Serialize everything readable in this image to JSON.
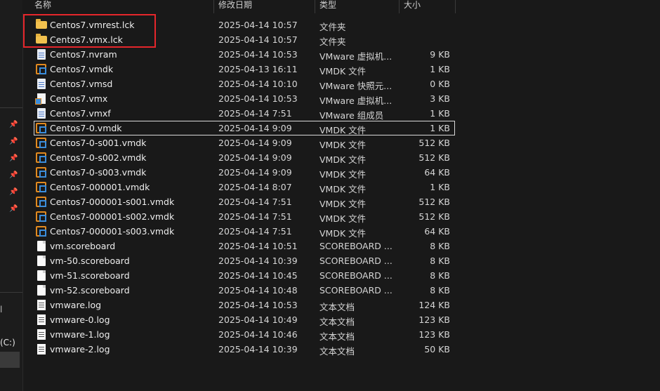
{
  "columns": {
    "name": "名称",
    "modified": "修改日期",
    "type": "类型",
    "size": "大小"
  },
  "nav": {
    "drive_label": "(C:)",
    "fragment_label": "l"
  },
  "files": [
    {
      "name": "Centos7.vmrest.lck",
      "date": "2025-04-14 10:57",
      "type": "文件夹",
      "size": "",
      "icon": "folder-icon"
    },
    {
      "name": "Centos7.vmx.lck",
      "date": "2025-04-14 10:57",
      "type": "文件夹",
      "size": "",
      "icon": "folder-icon"
    },
    {
      "name": "Centos7.nvram",
      "date": "2025-04-14 10:53",
      "type": "VMware 虚拟机...",
      "size": "9 KB",
      "icon": "nvram-file-icon"
    },
    {
      "name": "Centos7.vmdk",
      "date": "2025-04-13 16:11",
      "type": "VMDK 文件",
      "size": "1 KB",
      "icon": "vmdk-file-icon"
    },
    {
      "name": "Centos7.vmsd",
      "date": "2025-04-14 10:10",
      "type": "VMware 快照元...",
      "size": "0 KB",
      "icon": "vmsd-file-icon"
    },
    {
      "name": "Centos7.vmx",
      "date": "2025-04-14 10:53",
      "type": "VMware 虚拟机...",
      "size": "3 KB",
      "icon": "vmx-file-icon"
    },
    {
      "name": "Centos7.vmxf",
      "date": "2025-04-14 7:51",
      "type": "VMware 组成员",
      "size": "1 KB",
      "icon": "vmxf-file-icon"
    },
    {
      "name": "Centos7-0.vmdk",
      "date": "2025-04-14 9:09",
      "type": "VMDK 文件",
      "size": "1 KB",
      "icon": "vmdk-file-icon"
    },
    {
      "name": "Centos7-0-s001.vmdk",
      "date": "2025-04-14 9:09",
      "type": "VMDK 文件",
      "size": "512 KB",
      "icon": "vmdk-file-icon"
    },
    {
      "name": "Centos7-0-s002.vmdk",
      "date": "2025-04-14 9:09",
      "type": "VMDK 文件",
      "size": "512 KB",
      "icon": "vmdk-file-icon"
    },
    {
      "name": "Centos7-0-s003.vmdk",
      "date": "2025-04-14 9:09",
      "type": "VMDK 文件",
      "size": "64 KB",
      "icon": "vmdk-file-icon"
    },
    {
      "name": "Centos7-000001.vmdk",
      "date": "2025-04-14 8:07",
      "type": "VMDK 文件",
      "size": "1 KB",
      "icon": "vmdk-file-icon"
    },
    {
      "name": "Centos7-000001-s001.vmdk",
      "date": "2025-04-14 7:51",
      "type": "VMDK 文件",
      "size": "512 KB",
      "icon": "vmdk-file-icon"
    },
    {
      "name": "Centos7-000001-s002.vmdk",
      "date": "2025-04-14 7:51",
      "type": "VMDK 文件",
      "size": "512 KB",
      "icon": "vmdk-file-icon"
    },
    {
      "name": "Centos7-000001-s003.vmdk",
      "date": "2025-04-14 7:51",
      "type": "VMDK 文件",
      "size": "64 KB",
      "icon": "vmdk-file-icon"
    },
    {
      "name": "vm.scoreboard",
      "date": "2025-04-14 10:51",
      "type": "SCOREBOARD ...",
      "size": "8 KB",
      "icon": "blank-file-icon"
    },
    {
      "name": "vm-50.scoreboard",
      "date": "2025-04-14 10:39",
      "type": "SCOREBOARD ...",
      "size": "8 KB",
      "icon": "blank-file-icon"
    },
    {
      "name": "vm-51.scoreboard",
      "date": "2025-04-14 10:45",
      "type": "SCOREBOARD ...",
      "size": "8 KB",
      "icon": "blank-file-icon"
    },
    {
      "name": "vm-52.scoreboard",
      "date": "2025-04-14 10:48",
      "type": "SCOREBOARD ...",
      "size": "8 KB",
      "icon": "blank-file-icon"
    },
    {
      "name": "vmware.log",
      "date": "2025-04-14 10:53",
      "type": "文本文档",
      "size": "124 KB",
      "icon": "text-file-icon"
    },
    {
      "name": "vmware-0.log",
      "date": "2025-04-14 10:49",
      "type": "文本文档",
      "size": "123 KB",
      "icon": "text-file-icon"
    },
    {
      "name": "vmware-1.log",
      "date": "2025-04-14 10:46",
      "type": "文本文档",
      "size": "123 KB",
      "icon": "text-file-icon"
    },
    {
      "name": "vmware-2.log",
      "date": "2025-04-14 10:39",
      "type": "文本文档",
      "size": "50 KB",
      "icon": "text-file-icon"
    }
  ],
  "selected_row": 7,
  "highlighted_rows": [
    0,
    1
  ],
  "colors": {
    "background": "#191919",
    "highlight_box": "#e5262b",
    "folder": "#f2c14e",
    "vmdk_orange": "#e28a1f",
    "vmdk_blue": "#3b8ddb"
  }
}
